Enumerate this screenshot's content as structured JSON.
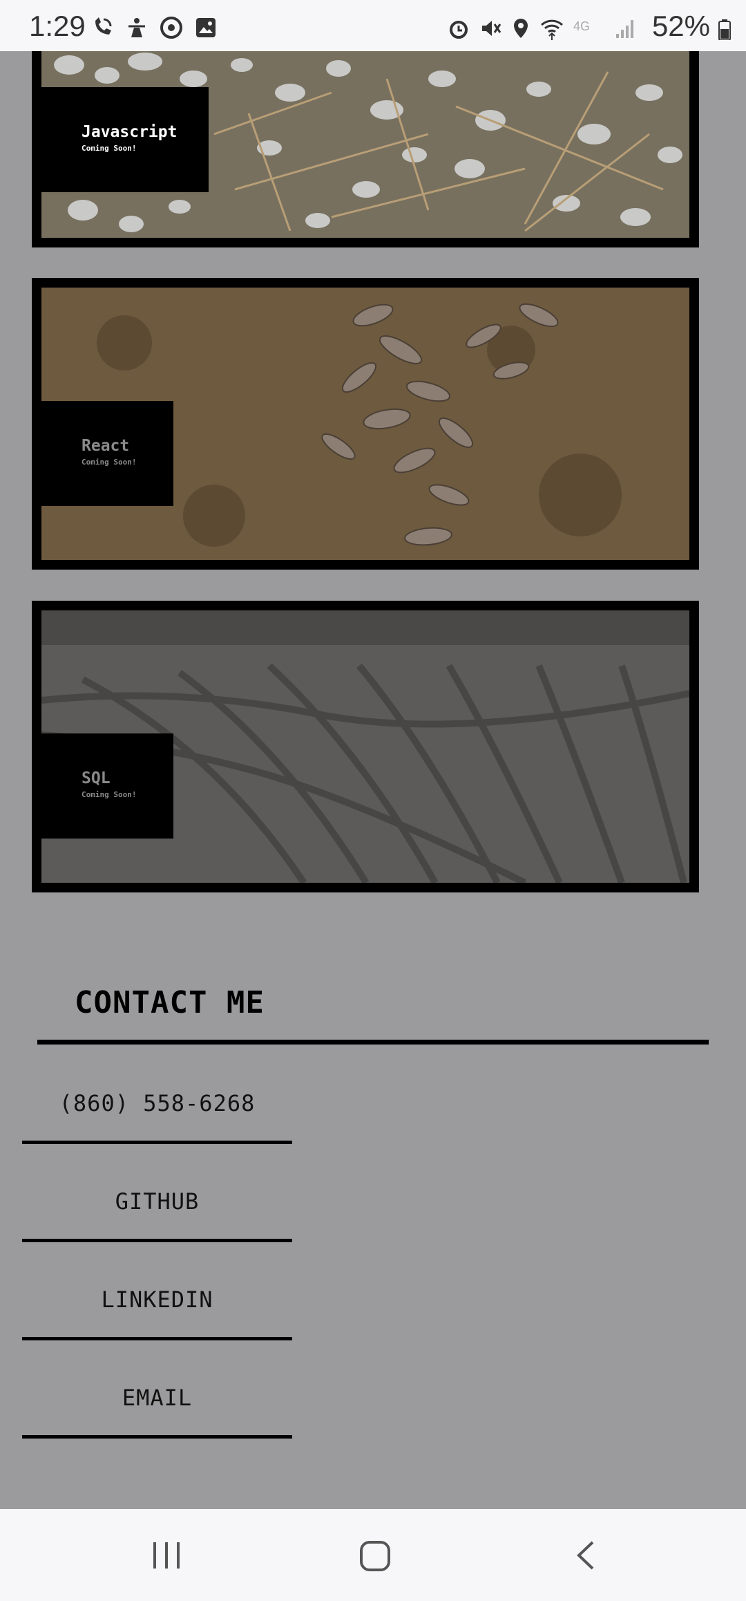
{
  "status_bar": {
    "time": "1:29",
    "battery": "52%",
    "left_icons": [
      "wifi-calling-icon",
      "accessibility-icon",
      "chrome-icon",
      "gallery-icon"
    ],
    "right_icons": [
      "alarm-icon",
      "mute-icon",
      "location-icon",
      "wifi-icon",
      "4g-icon",
      "signal-icon",
      "battery-icon"
    ]
  },
  "projects": [
    {
      "title": "Javascript",
      "subtitle": "Coming Soon!"
    },
    {
      "title": "React",
      "subtitle": "Coming Soon!"
    },
    {
      "title": "SQL",
      "subtitle": "Coming Soon!"
    }
  ],
  "contact": {
    "heading": "CONTACT ME",
    "phone": "(860) 558-6268",
    "github": "GITHUB",
    "linkedin": "LINKEDIN",
    "email": "EMAIL"
  },
  "nav_bar": {
    "icons": [
      "recent-apps-icon",
      "home-icon",
      "back-icon"
    ]
  },
  "colors": {
    "page_background": "#9b9b9d",
    "card_frame": "#000000",
    "bar_background": "#f7f7f9"
  }
}
